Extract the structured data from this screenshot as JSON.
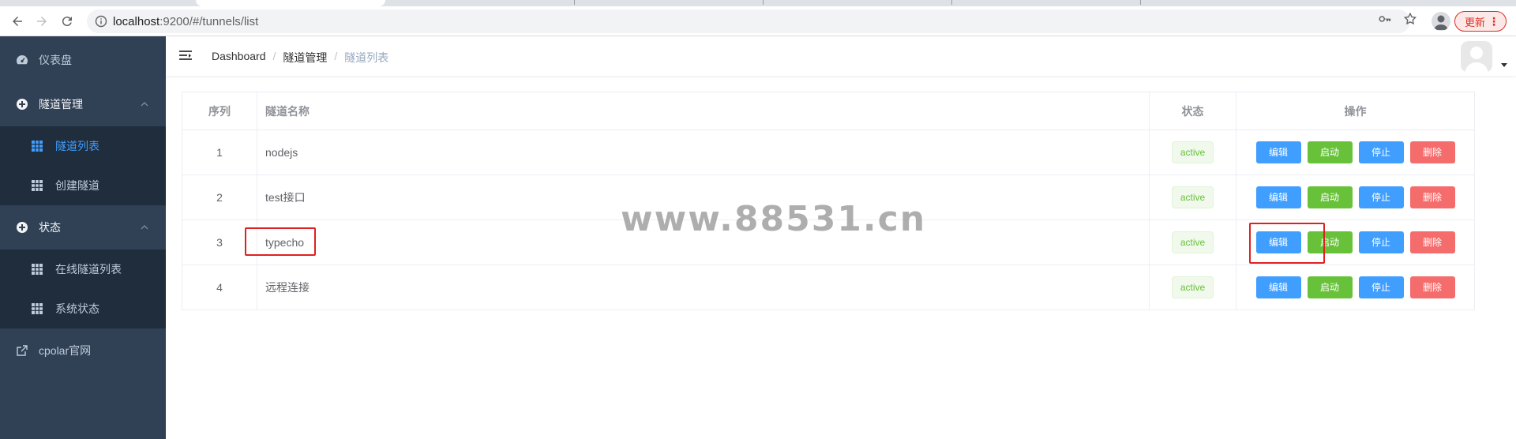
{
  "browser": {
    "url_host": "localhost",
    "url_rest": ":9200/#/tunnels/list",
    "update_label": "更新"
  },
  "sidebar": {
    "items": [
      {
        "label": "仪表盘",
        "icon": "dashboard-icon"
      },
      {
        "label": "隧道管理",
        "icon": "tunnel-manage-icon",
        "children": [
          {
            "label": "隧道列表",
            "icon": "grid-icon",
            "active": true
          },
          {
            "label": "创建隧道",
            "icon": "grid-icon"
          }
        ]
      },
      {
        "label": "状态",
        "icon": "status-icon",
        "children": [
          {
            "label": "在线隧道列表",
            "icon": "grid-icon"
          },
          {
            "label": "系统状态",
            "icon": "grid-icon"
          }
        ]
      },
      {
        "label": "cpolar官网",
        "icon": "external-link-icon"
      }
    ]
  },
  "breadcrumb": [
    "Dashboard",
    "隧道管理",
    "隧道列表"
  ],
  "table": {
    "headers": {
      "index": "序列",
      "name": "隧道名称",
      "status": "状态",
      "ops": "操作"
    },
    "rows": [
      {
        "index": "1",
        "name": "nodejs",
        "status": "active"
      },
      {
        "index": "2",
        "name": "test接口",
        "status": "active"
      },
      {
        "index": "3",
        "name": "typecho",
        "status": "active"
      },
      {
        "index": "4",
        "name": "远程连接",
        "status": "active"
      }
    ],
    "actions": {
      "edit": "编辑",
      "start": "启动",
      "stop": "停止",
      "delete": "删除"
    }
  },
  "watermark": "www.88531.cn",
  "colors": {
    "sidebar_bg": "#304156",
    "submenu_bg": "#1f2d3d",
    "accent": "#409eff",
    "success": "#67c23a",
    "danger": "#f56c6c",
    "highlight": "#e02020"
  }
}
